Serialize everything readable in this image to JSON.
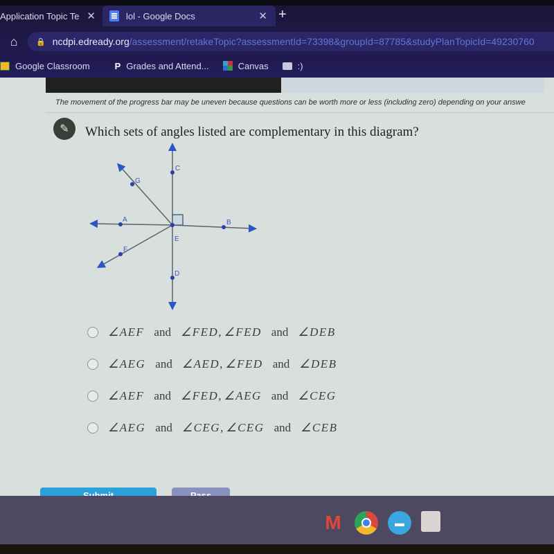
{
  "browser": {
    "tabs": [
      {
        "title": "Application Topic Te",
        "close": "✕",
        "active": false
      },
      {
        "title": "lol - Google Docs",
        "close": "✕",
        "active": true
      }
    ],
    "new_tab": "+",
    "url_host": "ncdpi.edready.org",
    "url_path": "/assessment/retakeTopic?assessmentId=73398&groupId=87785&studyPlanTopicId=49230760",
    "bookmarks": [
      {
        "label": "Google Classroom",
        "icon": "classroom-icon"
      },
      {
        "label": "Grades and Attend...",
        "icon": "powerschool-icon"
      },
      {
        "label": "Canvas",
        "icon": "canvas-icon"
      },
      {
        "label": ":)",
        "icon": "folder-icon"
      }
    ]
  },
  "assessment": {
    "progress_percent": 45,
    "notice": "The movement of the progress bar may be uneven because questions can be worth more or less (including zero) depending on your answe",
    "question": "Which sets of angles listed are complementary in this diagram?",
    "diagram_labels": {
      "A": "A",
      "B": "B",
      "C": "C",
      "D": "D",
      "E": "E",
      "F": "F",
      "G": "G"
    },
    "choices": [
      {
        "pairs": [
          [
            "∠AEF",
            "∠FED"
          ],
          [
            "∠FED",
            "∠DEB"
          ]
        ]
      },
      {
        "pairs": [
          [
            "∠AEG",
            "∠AED"
          ],
          [
            "∠FED",
            "∠DEB"
          ]
        ]
      },
      {
        "pairs": [
          [
            "∠AEF",
            "∠FED"
          ],
          [
            "∠AEG",
            "∠CEG"
          ]
        ]
      },
      {
        "pairs": [
          [
            "∠AEG",
            "∠CEG"
          ],
          [
            "∠CEG",
            "∠CEB"
          ]
        ]
      }
    ],
    "and_word": "and",
    "comma": ",",
    "submit_label": "Submit",
    "pass_label": "Pass"
  },
  "shelf": {
    "apps": [
      "gmail-icon",
      "chrome-icon",
      "files-icon",
      "launcher-icon"
    ]
  }
}
